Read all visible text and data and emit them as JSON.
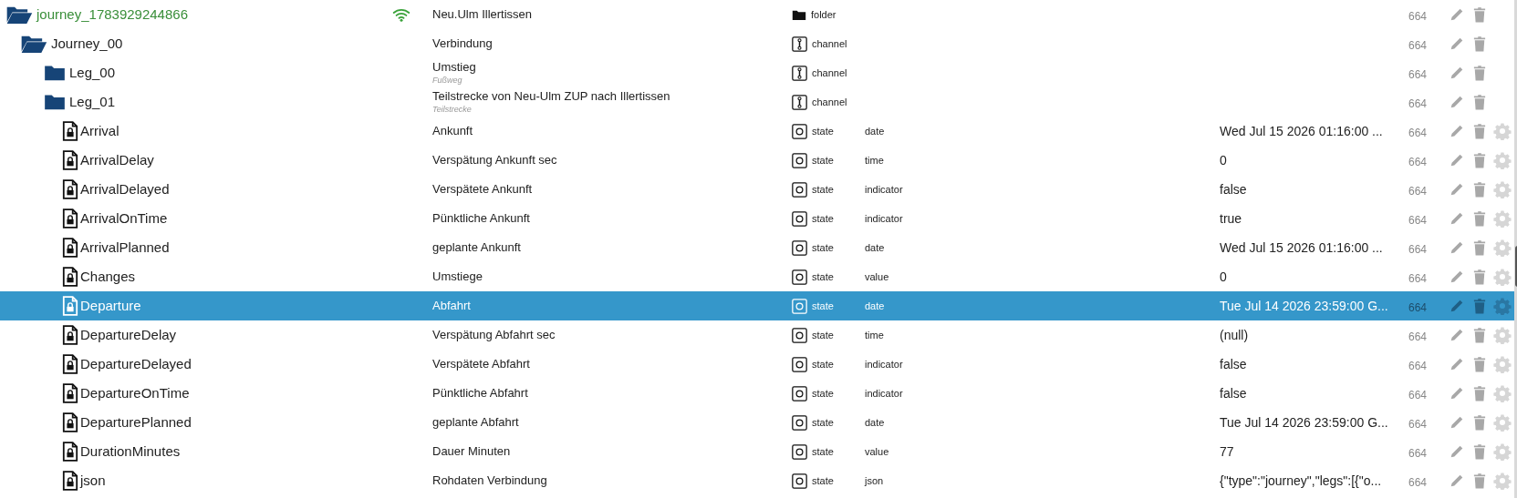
{
  "tree": [
    {
      "name": "journey_1783929244866",
      "kind": "folder",
      "expanded": true,
      "connected": true,
      "description": "Neu.Ulm Illertissen",
      "type": "folder",
      "acl": "664",
      "selected": false,
      "children": [
        {
          "name": "Journey_00",
          "kind": "folder",
          "expanded": true,
          "description": "Verbindung",
          "type": "channel",
          "acl": "664",
          "selected": false,
          "children": [
            {
              "name": "Leg_00",
              "kind": "folder",
              "expanded": false,
              "description": "Umstieg",
              "subtitle": "Fußweg",
              "type": "channel",
              "acl": "664",
              "selected": false
            },
            {
              "name": "Leg_01",
              "kind": "folder",
              "expanded": false,
              "description": "Teilstrecke von Neu-Ulm ZUP nach Illertissen",
              "subtitle": "Teilstrecke",
              "type": "channel",
              "acl": "664",
              "selected": false
            },
            {
              "name": "Arrival",
              "kind": "state",
              "description": "Ankunft",
              "type": "state",
              "role": "date",
              "value": "Wed Jul 15 2026 01:16:00 ...",
              "acl": "664",
              "selected": false
            },
            {
              "name": "ArrivalDelay",
              "kind": "state",
              "description": "Verspätung Ankunft sec",
              "type": "state",
              "role": "time",
              "value": "0",
              "acl": "664",
              "selected": false
            },
            {
              "name": "ArrivalDelayed",
              "kind": "state",
              "description": "Verspätete Ankunft",
              "type": "state",
              "role": "indicator",
              "value": "false",
              "acl": "664",
              "selected": false
            },
            {
              "name": "ArrivalOnTime",
              "kind": "state",
              "description": "Pünktliche Ankunft",
              "type": "state",
              "role": "indicator",
              "value": "true",
              "acl": "664",
              "selected": false
            },
            {
              "name": "ArrivalPlanned",
              "kind": "state",
              "description": "geplante Ankunft",
              "type": "state",
              "role": "date",
              "value": "Wed Jul 15 2026 01:16:00 ...",
              "acl": "664",
              "selected": false
            },
            {
              "name": "Changes",
              "kind": "state",
              "description": "Umstiege",
              "type": "state",
              "role": "value",
              "value": "0",
              "acl": "664",
              "selected": false
            },
            {
              "name": "Departure",
              "kind": "state",
              "description": "Abfahrt",
              "type": "state",
              "role": "date",
              "value": "Tue Jul 14 2026 23:59:00 G...",
              "acl": "664",
              "selected": true
            },
            {
              "name": "DepartureDelay",
              "kind": "state",
              "description": "Verspätung Abfahrt sec",
              "type": "state",
              "role": "time",
              "value": "(null)",
              "acl": "664",
              "selected": false
            },
            {
              "name": "DepartureDelayed",
              "kind": "state",
              "description": "Verspätete Abfahrt",
              "type": "state",
              "role": "indicator",
              "value": "false",
              "acl": "664",
              "selected": false
            },
            {
              "name": "DepartureOnTime",
              "kind": "state",
              "description": "Pünktliche Abfahrt",
              "type": "state",
              "role": "indicator",
              "value": "false",
              "acl": "664",
              "selected": false
            },
            {
              "name": "DeparturePlanned",
              "kind": "state",
              "description": "geplante Abfahrt",
              "type": "state",
              "role": "date",
              "value": "Tue Jul 14 2026 23:59:00 G...",
              "acl": "664",
              "selected": false
            },
            {
              "name": "DurationMinutes",
              "kind": "state",
              "description": "Dauer Minuten",
              "type": "state",
              "role": "value",
              "value": "77",
              "acl": "664",
              "selected": false
            },
            {
              "name": "json",
              "kind": "state",
              "description": "Rohdaten Verbindung",
              "type": "state",
              "role": "json",
              "value": "{\"type\":\"journey\",\"legs\":[{\"o...",
              "acl": "664",
              "selected": false
            }
          ]
        }
      ]
    }
  ]
}
